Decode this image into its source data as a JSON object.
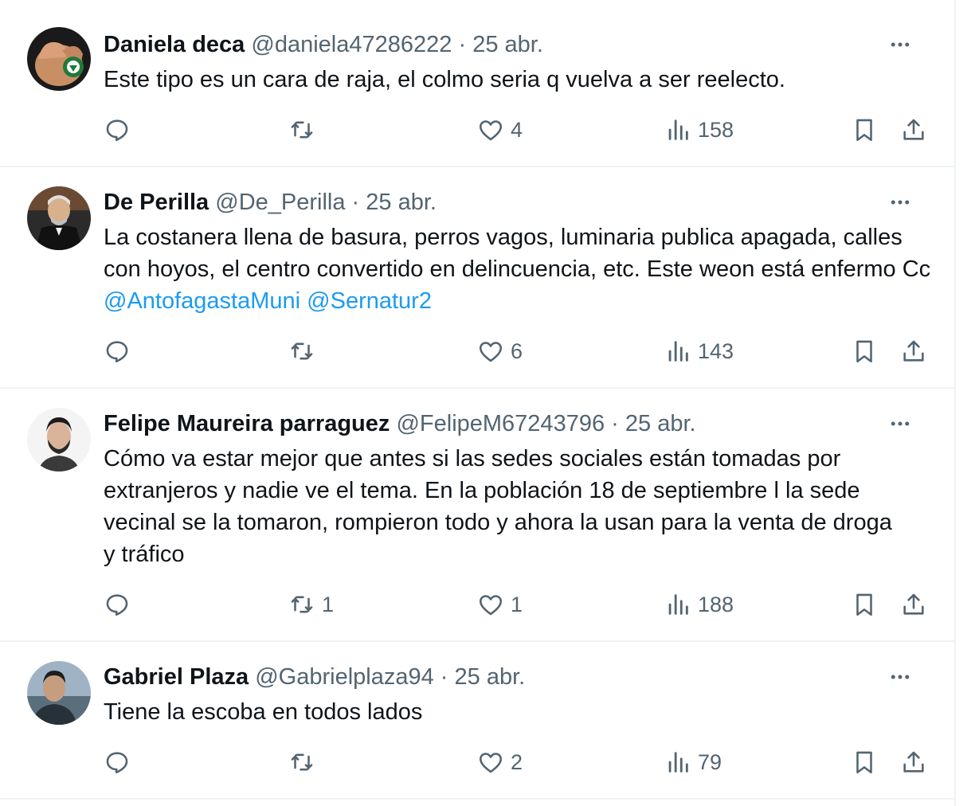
{
  "tweets": [
    {
      "name": "Daniela deca",
      "handle": "@daniela47286222",
      "separator": "·",
      "date": "25 abr.",
      "text": "Este tipo es un cara  de raja, el colmo seria q vuelva a ser reelecto.",
      "mentions": [],
      "replies": "",
      "retweets": "",
      "likes": "4",
      "views": "158",
      "avatar_icon": "sports-club-badge-avatar"
    },
    {
      "name": "De Perilla",
      "handle": "@De_Perilla",
      "separator": "·",
      "date": "25 abr.",
      "text": "La costanera llena de basura, perros vagos, luminaria publica apagada, calles con hoyos, el centro convertido en delincuencia, etc. Este weon está enfermo Cc ",
      "mentions": [
        "@AntofagastaMuni",
        "@Sernatur2"
      ],
      "replies": "",
      "retweets": "",
      "likes": "6",
      "views": "143",
      "avatar_icon": "bearded-man-photo-avatar"
    },
    {
      "name": "Felipe Maureira parraguez",
      "handle": "@FelipeM67243796",
      "separator": "·",
      "date": "25 abr.",
      "text": "Cómo va estar mejor que antes si las sedes sociales están tomadas por extranjeros y nadie ve el tema. En la población 18 de septiembre l la sede vecinal se la tomaron, rompieron todo y ahora la usan para la venta de droga y tráfico",
      "mentions": [],
      "replies": "",
      "retweets": "1",
      "likes": "1",
      "views": "188",
      "avatar_icon": "man-portrait-avatar"
    },
    {
      "name": "Gabriel Plaza",
      "handle": "@Gabrielplaza94",
      "separator": "·",
      "date": "25 abr.",
      "text": "Tiene la escoba en todos lados",
      "mentions": [],
      "replies": "",
      "retweets": "",
      "likes": "2",
      "views": "79",
      "avatar_icon": "man-outdoor-photo-avatar"
    }
  ],
  "icons": {
    "more": "more-dots-icon",
    "reply": "reply-icon",
    "retweet": "retweet-icon",
    "like": "like-heart-icon",
    "views": "views-chart-icon",
    "bookmark": "bookmark-icon",
    "share": "share-icon"
  },
  "colors": {
    "text": "#0f1419",
    "secondary": "#536471",
    "link": "#1d9bf0",
    "divider": "#eff3f4"
  }
}
